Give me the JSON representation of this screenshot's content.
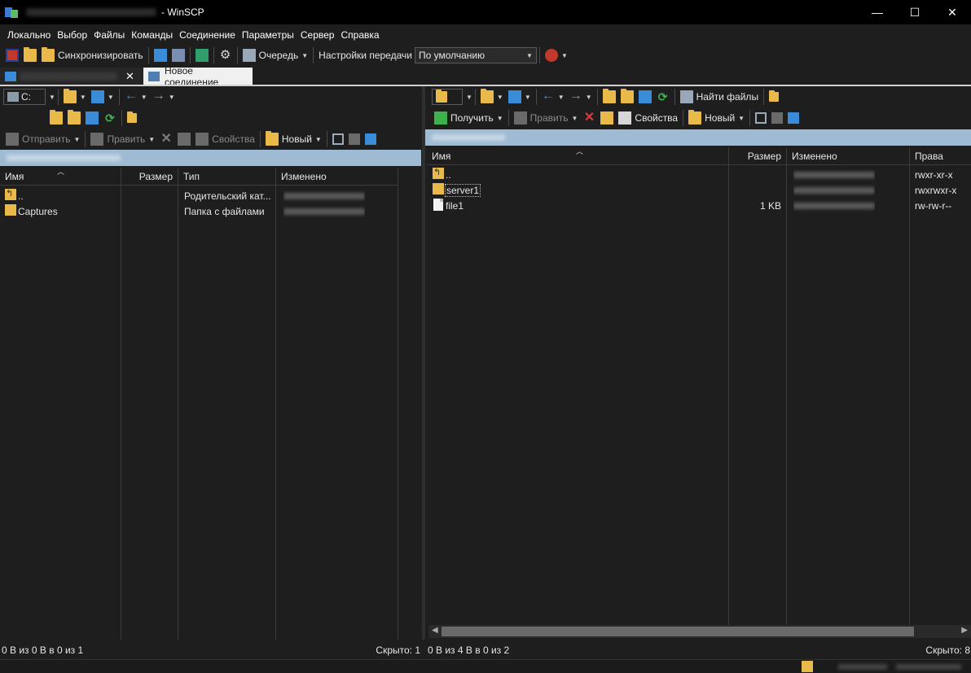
{
  "titlebar": {
    "title": "- WinSCP",
    "minimize": "—",
    "maximize": "☐",
    "close": "✕"
  },
  "menu": [
    "Локально",
    "Выбор",
    "Файлы",
    "Команды",
    "Соединение",
    "Параметры",
    "Сервер",
    "Справка"
  ],
  "main_toolbar": {
    "sync_label": "Синхронизировать",
    "queue_label": "Очередь",
    "transfer_settings_label": "Настройки передачи",
    "transfer_preset_value": "По умолчанию"
  },
  "tabs": {
    "new_session_label": "Новое соединение",
    "close_glyph": "✕"
  },
  "left_panel": {
    "drive_label": "C:",
    "toolbar": {
      "send": "Отправить",
      "edit": "Править",
      "properties": "Свойства",
      "new": "Новый"
    },
    "columns": [
      "Имя",
      "Размер",
      "Тип",
      "Изменено"
    ],
    "rows": [
      {
        "name": "..",
        "size": "",
        "type": "Родительский кат...",
        "icon": "parent-folder-icon"
      },
      {
        "name": "Captures",
        "size": "",
        "type": "Папка с файлами",
        "icon": "folder-icon"
      }
    ],
    "status_left": "0 B из 0 B в 0 из 1",
    "status_right": "Скрыто: 1"
  },
  "right_panel": {
    "toolbar_top": {
      "find_files": "Найти файлы"
    },
    "toolbar": {
      "get": "Получить",
      "edit": "Править",
      "properties": "Свойства",
      "new": "Новый"
    },
    "columns": [
      "Имя",
      "Размер",
      "Изменено",
      "Права"
    ],
    "rows": [
      {
        "name": "..",
        "size": "",
        "rights": "rwxr-xr-x",
        "icon": "parent-folder-icon"
      },
      {
        "name": "server1",
        "size": "",
        "rights": "rwxrwxr-x",
        "icon": "folder-icon"
      },
      {
        "name": "file1",
        "size": "1 KB",
        "rights": "rw-rw-r--",
        "icon": "file-icon"
      }
    ],
    "status_left": "0 B из 4 B в 0 из 2",
    "status_right": "Скрыто: 8"
  },
  "colors": {
    "pathbar": "#9fbbd4",
    "background": "#1e1e1e",
    "folder": "#e9b949"
  }
}
